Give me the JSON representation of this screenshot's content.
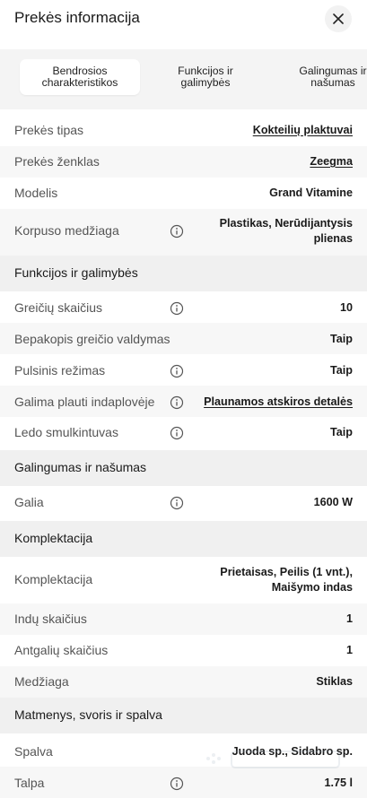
{
  "header": {
    "title": "Prekės informacija"
  },
  "tabs": [
    {
      "line1": "Bendrosios",
      "line2": "charakteristikos"
    },
    {
      "line1": "Funkcijos ir",
      "line2": "galimybės"
    },
    {
      "line1": "Galingumas ir",
      "line2": "našumas"
    }
  ],
  "general": {
    "type_label": "Prekės tipas",
    "type_value": "Kokteilių plaktuvai",
    "brand_label": "Prekės ženklas",
    "brand_value": "Zeegma",
    "model_label": "Modelis",
    "model_value": "Grand Vitamine",
    "material_label": "Korpuso medžiaga",
    "material_value_1": "Plastikas, Nerūdijantysis",
    "material_value_2": "plienas"
  },
  "functions": {
    "title": "Funkcijos ir galimybės",
    "speeds_label": "Greičių skaičius",
    "speeds_value": "10",
    "stepless_label": "Bepakopis greičio valdymas",
    "stepless_value": "Taip",
    "pulse_label": "Pulsinis režimas",
    "pulse_value": "Taip",
    "dishwasher_label": "Galima plauti indaplovėje",
    "dishwasher_value": "Plaunamos atskiros detalės",
    "ice_label": "Ledo smulkintuvas",
    "ice_value": "Taip"
  },
  "power": {
    "title": "Galingumas ir našumas",
    "power_label": "Galia",
    "power_value": "1600 W"
  },
  "kit": {
    "title": "Komplektacija",
    "kit_label": "Komplektacija",
    "kit_value_1": "Prietaisas, Peilis (1 vnt.),",
    "kit_value_2": "Maišymo indas",
    "dishes_label": "Indų skaičius",
    "dishes_value": "1",
    "lids_label": "Antgalių skaičius",
    "lids_value": "1",
    "mat_label": "Medžiaga",
    "mat_value": "Stiklas"
  },
  "dims": {
    "title": "Matmenys, svoris ir spalva",
    "color_label": "Spalva",
    "color_value": "Juoda sp., Sidabro sp.",
    "volume_label": "Talpa",
    "volume_value": "1.75 l"
  },
  "colors": {
    "section_bg": "#f0f0f0",
    "alt_row_bg": "#f7f7f7",
    "text_dark": "#1a1a1a",
    "text_label": "#555555"
  },
  "icons": {
    "close": "close-icon",
    "info": "info-icon"
  }
}
